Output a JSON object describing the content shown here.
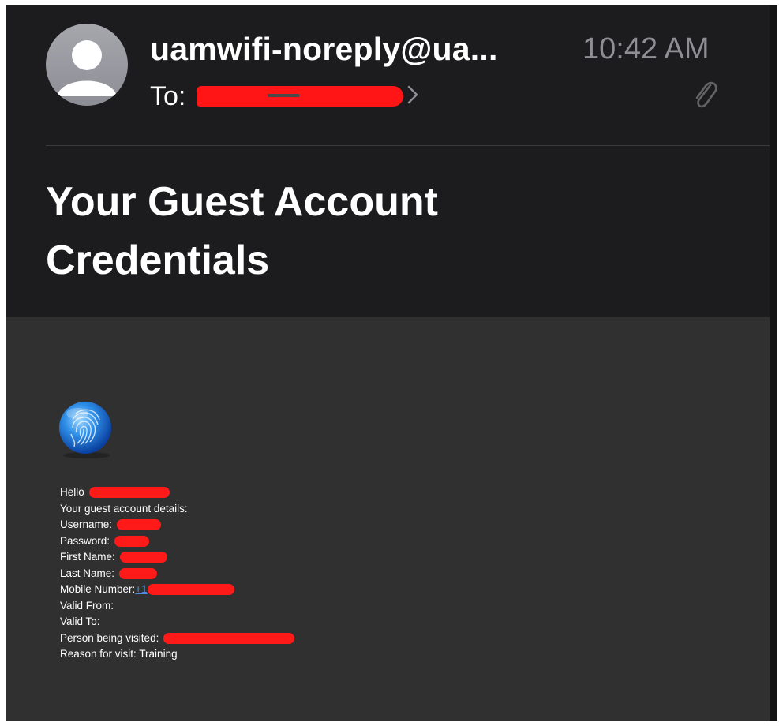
{
  "header": {
    "sender": "uamwifi-noreply@ua...",
    "time": "10:42 AM",
    "to_label": "To:"
  },
  "subject": {
    "line1": "Your Guest Account",
    "line2": "Credentials"
  },
  "body": {
    "greeting": "Hello",
    "intro": "Your guest account details:",
    "fields": [
      {
        "label": "Username:",
        "value": ""
      },
      {
        "label": "Password:",
        "value": ""
      },
      {
        "label": "First Name:",
        "value": ""
      },
      {
        "label": "Last Name:",
        "value": ""
      },
      {
        "label": "Mobile Number:",
        "value": "+1"
      },
      {
        "label": "Valid From:",
        "value": ""
      },
      {
        "label": "Valid To:",
        "value": ""
      },
      {
        "label": "Person being visited:",
        "value": ""
      },
      {
        "label": "Reason for visit:",
        "value": "Training"
      }
    ]
  },
  "colors": {
    "background": "#1c1c1e",
    "body_panel": "#303030",
    "redaction": "#ff1515",
    "link": "#4a90e2",
    "secondary_text": "#8e8e93"
  },
  "icons": {
    "avatar": "person-avatar-icon",
    "attachment": "paperclip-icon",
    "chevron": "chevron-right-icon",
    "logo": "fingerprint-globe-logo"
  }
}
